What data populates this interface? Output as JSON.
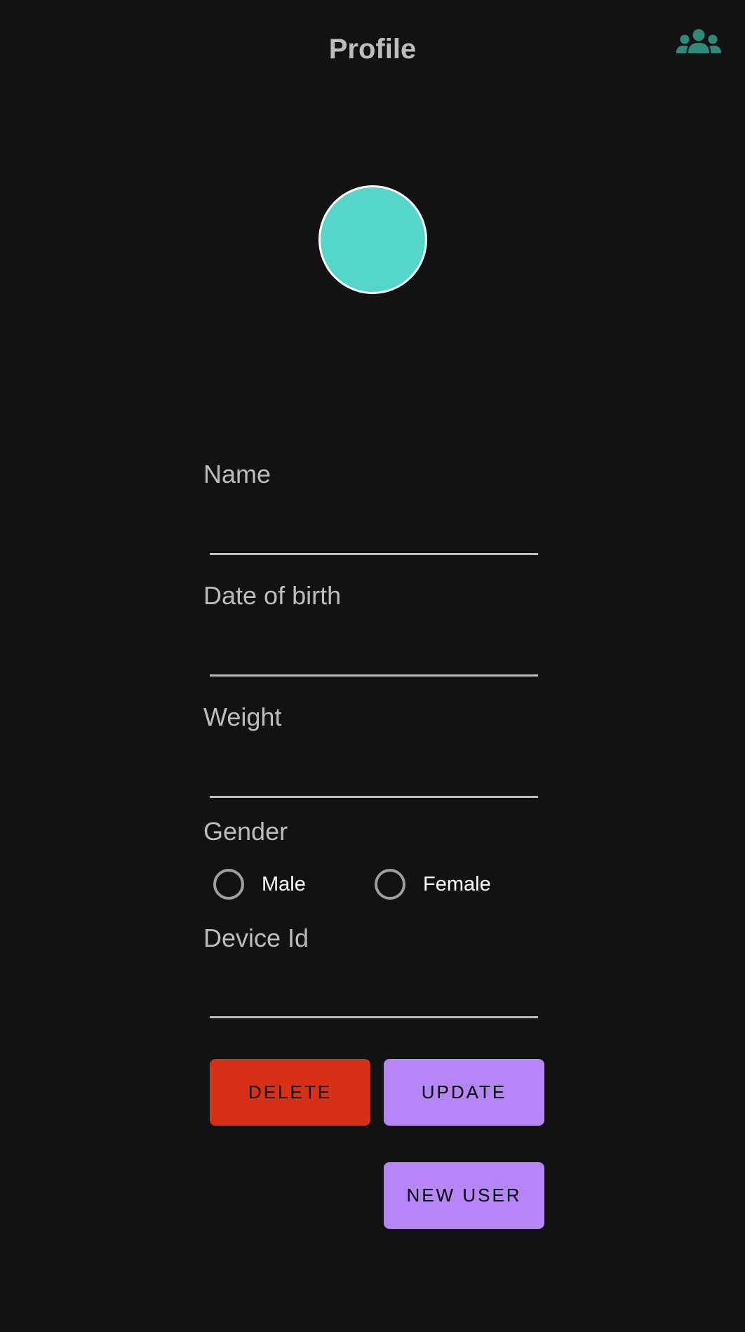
{
  "header": {
    "title": "Profile",
    "users_icon": "group-icon",
    "accent_color": "#2e8b7a"
  },
  "avatar": {
    "color": "#56d6c8"
  },
  "form": {
    "name_label": "Name",
    "name_value": "",
    "dob_label": "Date of birth",
    "dob_value": "",
    "weight_label": "Weight",
    "weight_value": "",
    "gender_label": "Gender",
    "gender_options": [
      "Male",
      "Female"
    ],
    "gender_selected": null,
    "device_id_label": "Device Id",
    "device_id_value": ""
  },
  "buttons": {
    "delete_label": "DELETE",
    "update_label": "UPDATE",
    "new_user_label": "NEW USER"
  },
  "colors": {
    "background": "#121212",
    "delete": "#d82f17",
    "primary": "#b686f7"
  }
}
